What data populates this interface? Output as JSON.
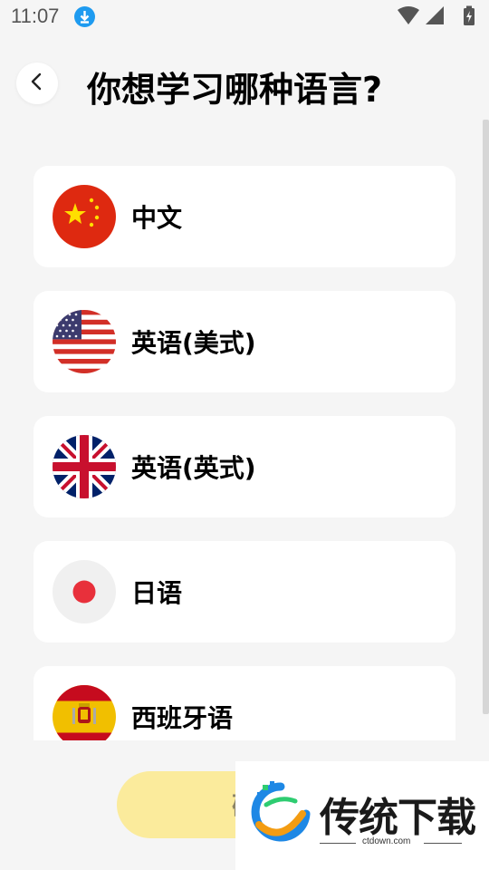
{
  "status_bar": {
    "time": "11:07",
    "download_icon": "download-icon",
    "icons": [
      "wifi-icon",
      "signal-icon",
      "battery-charging-icon"
    ]
  },
  "header": {
    "back_icon": "chevron-left-icon",
    "title": "你想学习哪种语言?"
  },
  "languages": [
    {
      "label": "中文",
      "flag": "china-flag-icon"
    },
    {
      "label": "英语(美式)",
      "flag": "usa-flag-icon"
    },
    {
      "label": "英语(英式)",
      "flag": "uk-flag-icon"
    },
    {
      "label": "日语",
      "flag": "japan-flag-icon"
    },
    {
      "label": "西班牙语",
      "flag": "spain-flag-icon"
    }
  ],
  "confirm_button": {
    "label": "确"
  },
  "watermark": {
    "text": "传统下载",
    "url": "ctdown.com",
    "logo_icon": "ctdown-logo-icon"
  },
  "colors": {
    "background": "#f5f5f5",
    "card": "#ffffff",
    "confirm_button": "#fbeb9c",
    "download_badge": "#1e9bf0"
  }
}
